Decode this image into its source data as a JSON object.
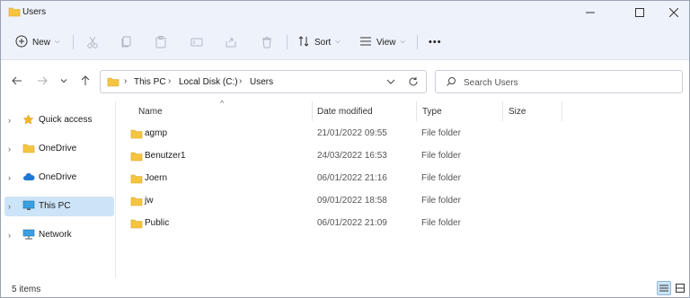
{
  "window": {
    "title": "Users",
    "controls": {
      "minimize": "minimize",
      "maximize": "maximize",
      "close": "close"
    }
  },
  "toolbar": {
    "new_label": "New",
    "sort_label": "Sort",
    "view_label": "View",
    "more_label": "•••"
  },
  "address": {
    "crumbs": [
      "This PC",
      "Local Disk (C:)",
      "Users"
    ]
  },
  "search": {
    "placeholder": "Search Users"
  },
  "navpane": {
    "items": [
      {
        "label": "Quick access",
        "icon": "star-icon",
        "selected": false
      },
      {
        "label": "OneDrive",
        "icon": "folder-icon",
        "selected": false
      },
      {
        "label": "OneDrive",
        "icon": "cloud-icon",
        "selected": false
      },
      {
        "label": "This PC",
        "icon": "monitor-icon",
        "selected": true
      },
      {
        "label": "Network",
        "icon": "network-icon",
        "selected": false
      }
    ]
  },
  "columns": {
    "name": "Name",
    "date": "Date modified",
    "type": "Type",
    "size": "Size"
  },
  "files": [
    {
      "name": "agmp",
      "date": "21/01/2022 09:55",
      "type": "File folder"
    },
    {
      "name": "Benutzer1",
      "date": "24/03/2022 16:53",
      "type": "File folder"
    },
    {
      "name": "Joern",
      "date": "06/01/2022 21:16",
      "type": "File folder"
    },
    {
      "name": "jw",
      "date": "09/01/2022 18:58",
      "type": "File folder"
    },
    {
      "name": "Public",
      "date": "06/01/2022 21:09",
      "type": "File folder"
    }
  ],
  "status": {
    "count": "5 items"
  },
  "colors": {
    "accent": "#0067c0",
    "selection": "#cce4f7",
    "folder": "#f5c542"
  }
}
